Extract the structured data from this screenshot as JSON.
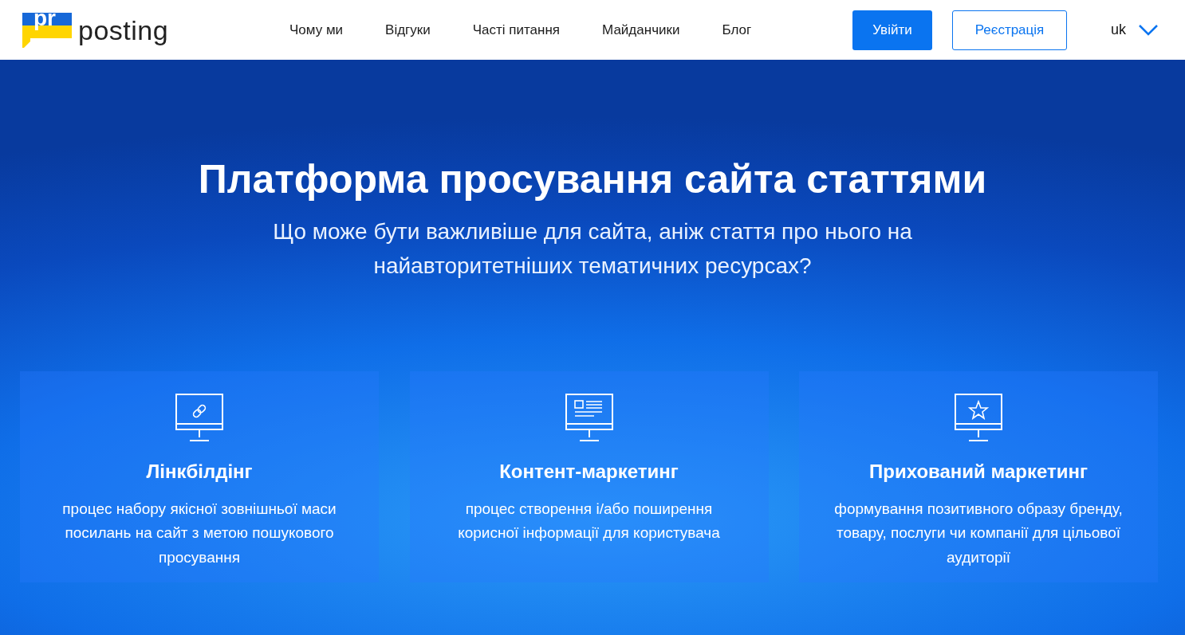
{
  "header": {
    "logo": {
      "mark": "pr",
      "name": "posting"
    },
    "nav": [
      {
        "label": "Чому ми"
      },
      {
        "label": "Відгуки"
      },
      {
        "label": "Часті питання"
      },
      {
        "label": "Майданчики"
      },
      {
        "label": "Блог"
      }
    ],
    "login_button": "Увійти",
    "register_button": "Реєстрація",
    "language": "uk"
  },
  "hero": {
    "title": "Платформа просування сайта статтями",
    "subtitle": "Що може бути важливіше для сайта, аніж стаття про нього на найавторитетніших тематичних ресурсах?"
  },
  "features": [
    {
      "kind": "link",
      "title": "Лінкбілдінг",
      "text": "процес набору якісної зовнішньої маси посилань на сайт з метою пошукового просування"
    },
    {
      "kind": "article",
      "title": "Контент-маркетинг",
      "text": "процес створення і/або поширення корисної інформації для користувача"
    },
    {
      "kind": "star",
      "title": "Прихований маркетинг",
      "text": "формування позитивного образу бренду, товару, послуги чи компанії для цільової аудиторії"
    }
  ]
}
